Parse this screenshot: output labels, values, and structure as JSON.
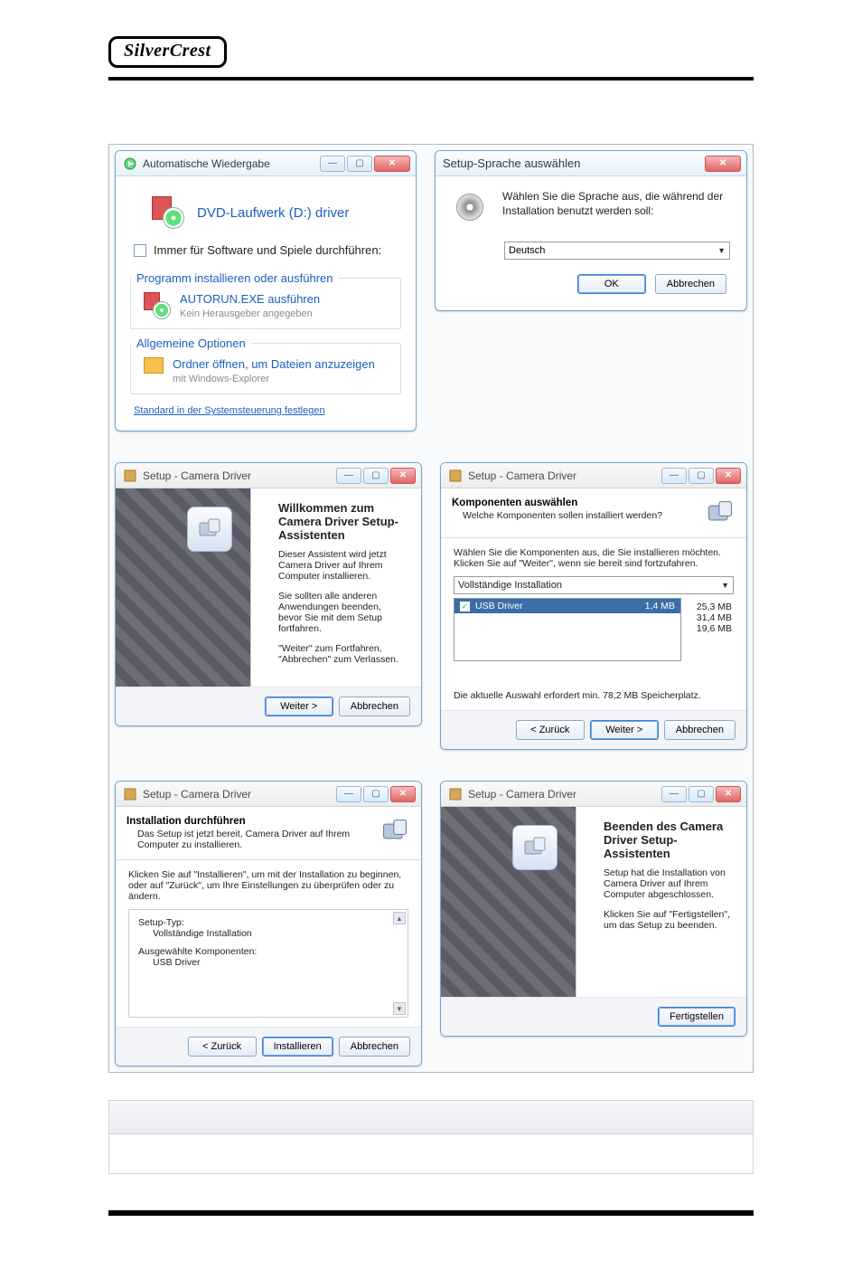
{
  "brand": "SilverCrest",
  "autoplay": {
    "title": "Automatische Wiedergabe",
    "drive": "DVD-Laufwerk (D:) driver",
    "always_label": "Immer für Software und Spiele durchführen:",
    "group_install": "Programm installieren oder ausführen",
    "autorun_line1": "AUTORUN.EXE ausführen",
    "autorun_line2": "Kein Herausgeber angegeben",
    "group_general": "Allgemeine Optionen",
    "open_folder_line1": "Ordner öffnen, um Dateien anzuzeigen",
    "open_folder_line2": "mit Windows-Explorer",
    "control_panel_link": "Standard in der Systemsteuerung festlegen"
  },
  "lang": {
    "title": "Setup-Sprache auswählen",
    "prompt": "Wählen Sie die Sprache aus, die während der Installation benutzt werden soll:",
    "value": "Deutsch",
    "ok": "OK",
    "cancel": "Abbrechen"
  },
  "wiz_common_title": "Setup - Camera Driver",
  "wiz1": {
    "heading": "Willkommen zum Camera Driver Setup-Assistenten",
    "p1": "Dieser Assistent wird jetzt Camera Driver auf Ihrem Computer installieren.",
    "p2": "Sie sollten alle anderen Anwendungen beenden, bevor Sie mit dem Setup fortfahren.",
    "p3": "\"Weiter\" zum Fortfahren, \"Abbrechen\" zum Verlassen.",
    "next": "Weiter >",
    "cancel": "Abbrechen"
  },
  "wiz2": {
    "h1": "Komponenten auswählen",
    "h2": "Welche Komponenten sollen installiert werden?",
    "instr": "Wählen Sie die Komponenten aus, die Sie installieren möchten. Klicken Sie auf \"Weiter\", wenn sie bereit sind fortzufahren.",
    "preset": "Vollständige Installation",
    "item": "USB Driver",
    "item_size": "1,4 MB",
    "sizes": [
      "25,3 MB",
      "31,4 MB",
      "19,6 MB"
    ],
    "req": "Die aktuelle Auswahl erfordert min. 78,2 MB Speicherplatz.",
    "back": "< Zurück",
    "next": "Weiter >",
    "cancel": "Abbrechen"
  },
  "wiz3": {
    "h1": "Installation durchführen",
    "h2": "Das Setup ist jetzt bereit, Camera Driver auf Ihrem Computer zu installieren.",
    "instr": "Klicken Sie auf \"Installieren\", um mit der Installation zu beginnen, oder auf \"Zurück\", um Ihre Einstellungen zu überprüfen oder zu ändern.",
    "type_label": "Setup-Typ:",
    "type_value": "Vollständige Installation",
    "comp_label": "Ausgewählte Komponenten:",
    "comp_value": "USB Driver",
    "back": "< Zurück",
    "install": "Installieren",
    "cancel": "Abbrechen"
  },
  "wiz4": {
    "heading": "Beenden des Camera Driver Setup-Assistenten",
    "p1": "Setup hat die Installation von Camera Driver auf Ihrem Computer abgeschlossen.",
    "p2": "Klicken Sie auf \"Fertigstellen\", um das Setup zu beenden.",
    "finish": "Fertigstellen"
  }
}
